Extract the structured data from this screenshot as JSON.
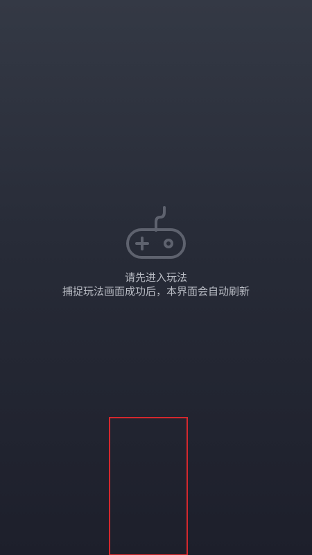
{
  "empty_state": {
    "icon": "gamepad-icon",
    "line1": "请先进入玩法",
    "line2": "捕捉玩法画面成功后，本界面会自动刷新"
  },
  "colors": {
    "background_top": "#343945",
    "background_bottom": "#1d1f2b",
    "text": "#b9bcc4",
    "icon": "#5e626e",
    "highlight_border": "#d4282d"
  }
}
